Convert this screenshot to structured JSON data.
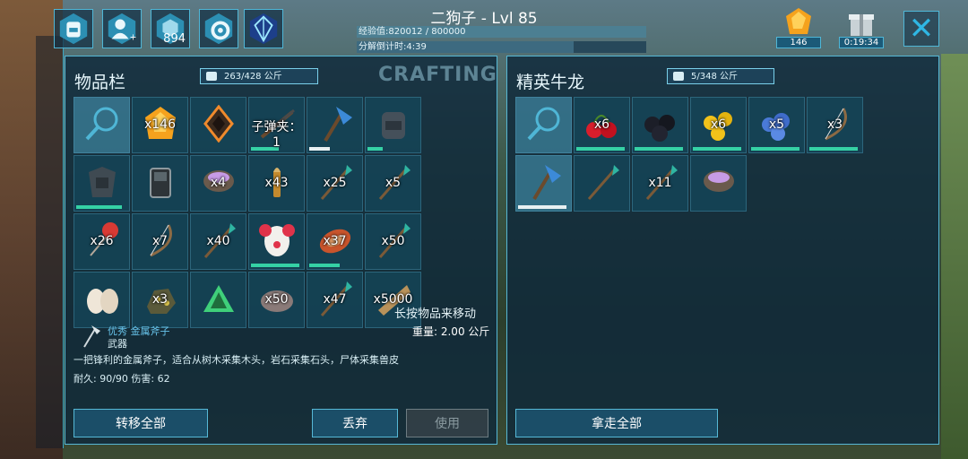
{
  "header": {
    "player_name": "二狗子 - Lvl 85",
    "xp_text": "经验值:820012 / 800000",
    "xp_fraction": 1.0,
    "timer_text": "分解倒计时:4:39",
    "timer_fraction": 0.75,
    "level_up_count": "894"
  },
  "resources": {
    "amber_count": "146",
    "gift_timer": "0:19:34"
  },
  "inventory": {
    "title": "物品栏",
    "weight": "263/428 公斤",
    "crafting_label": "CRAFTING",
    "slots": [
      {
        "icon": "magnifier-icon",
        "qty": "",
        "sel": true
      },
      {
        "icon": "amber-icon",
        "qty": "x146"
      },
      {
        "icon": "implant-icon",
        "qty": ""
      },
      {
        "icon": "shotgun-icon",
        "qty": "子弹夹：1",
        "dur": 0.55
      },
      {
        "icon": "axe-icon",
        "qty": "",
        "dur": 0.4,
        "durcolor": "white"
      },
      {
        "icon": "backpack-icon",
        "qty": "",
        "dur": 0.3
      },
      {
        "icon": "armor-icon",
        "qty": "",
        "dur": 0.9,
        "durcolor": "green"
      },
      {
        "icon": "radio-icon",
        "qty": ""
      },
      {
        "icon": "mortar-icon",
        "qty": "x4"
      },
      {
        "icon": "bullet-icon",
        "qty": "x43"
      },
      {
        "icon": "spear-icon",
        "qty": "x25"
      },
      {
        "icon": "spear-icon",
        "qty": "x5"
      },
      {
        "icon": "feather-icon",
        "qty": "x26"
      },
      {
        "icon": "bow-icon",
        "qty": "x7"
      },
      {
        "icon": "spear-icon",
        "qty": "x40"
      },
      {
        "icon": "clown-mask-icon",
        "qty": "",
        "dur": 0.95
      },
      {
        "icon": "meat-icon",
        "qty": "x37",
        "dur": 0.6
      },
      {
        "icon": "spear-icon",
        "qty": "x50"
      },
      {
        "icon": "slipper-icon",
        "qty": ""
      },
      {
        "icon": "ore-icon",
        "qty": "x3"
      },
      {
        "icon": "crystal-icon",
        "qty": ""
      },
      {
        "icon": "stone-icon",
        "qty": "x50"
      },
      {
        "icon": "spear-icon",
        "qty": "x47"
      },
      {
        "icon": "thatch-icon",
        "qty": "x5000"
      }
    ],
    "overlay_hint": "长按物品来移动",
    "item": {
      "quality": "优秀",
      "name": "金属斧子",
      "category": "武器",
      "weight": "重量: 2.00 公斤",
      "description": "一把锋利的金属斧子，适合从树木采集木头，岩石采集石头，尸体采集兽皮",
      "stats": "耐久: 90/90  伤害: 62"
    },
    "buttons": {
      "transfer_all": "转移全部",
      "drop": "丢弃",
      "use": "使用"
    }
  },
  "creature": {
    "title": "精英牛龙",
    "weight": "5/348 公斤",
    "slots": [
      {
        "icon": "magnifier-icon",
        "qty": "",
        "sel": true
      },
      {
        "icon": "berry-red-icon",
        "qty": "x6",
        "dur": 0.95
      },
      {
        "icon": "berry-black-icon",
        "qty": "",
        "dur": 0.95
      },
      {
        "icon": "berry-yellow-icon",
        "qty": "x6",
        "dur": 0.95
      },
      {
        "icon": "berry-blue-icon",
        "qty": "x5",
        "dur": 0.95
      },
      {
        "icon": "bow-icon",
        "qty": "x3",
        "dur": 0.95
      },
      {
        "icon": "axe-icon",
        "qty": "",
        "sel": true,
        "dur": 0.95,
        "durcolor": "white"
      },
      {
        "icon": "spear-icon",
        "qty": ""
      },
      {
        "icon": "spear-icon",
        "qty": "x11"
      },
      {
        "icon": "mortar-icon",
        "qty": ""
      }
    ],
    "buttons": {
      "take_all": "拿走全部"
    }
  },
  "colors": {
    "accent": "#4fb6d6",
    "panel": "#0f283a",
    "durability_green": "#35d1a5"
  }
}
